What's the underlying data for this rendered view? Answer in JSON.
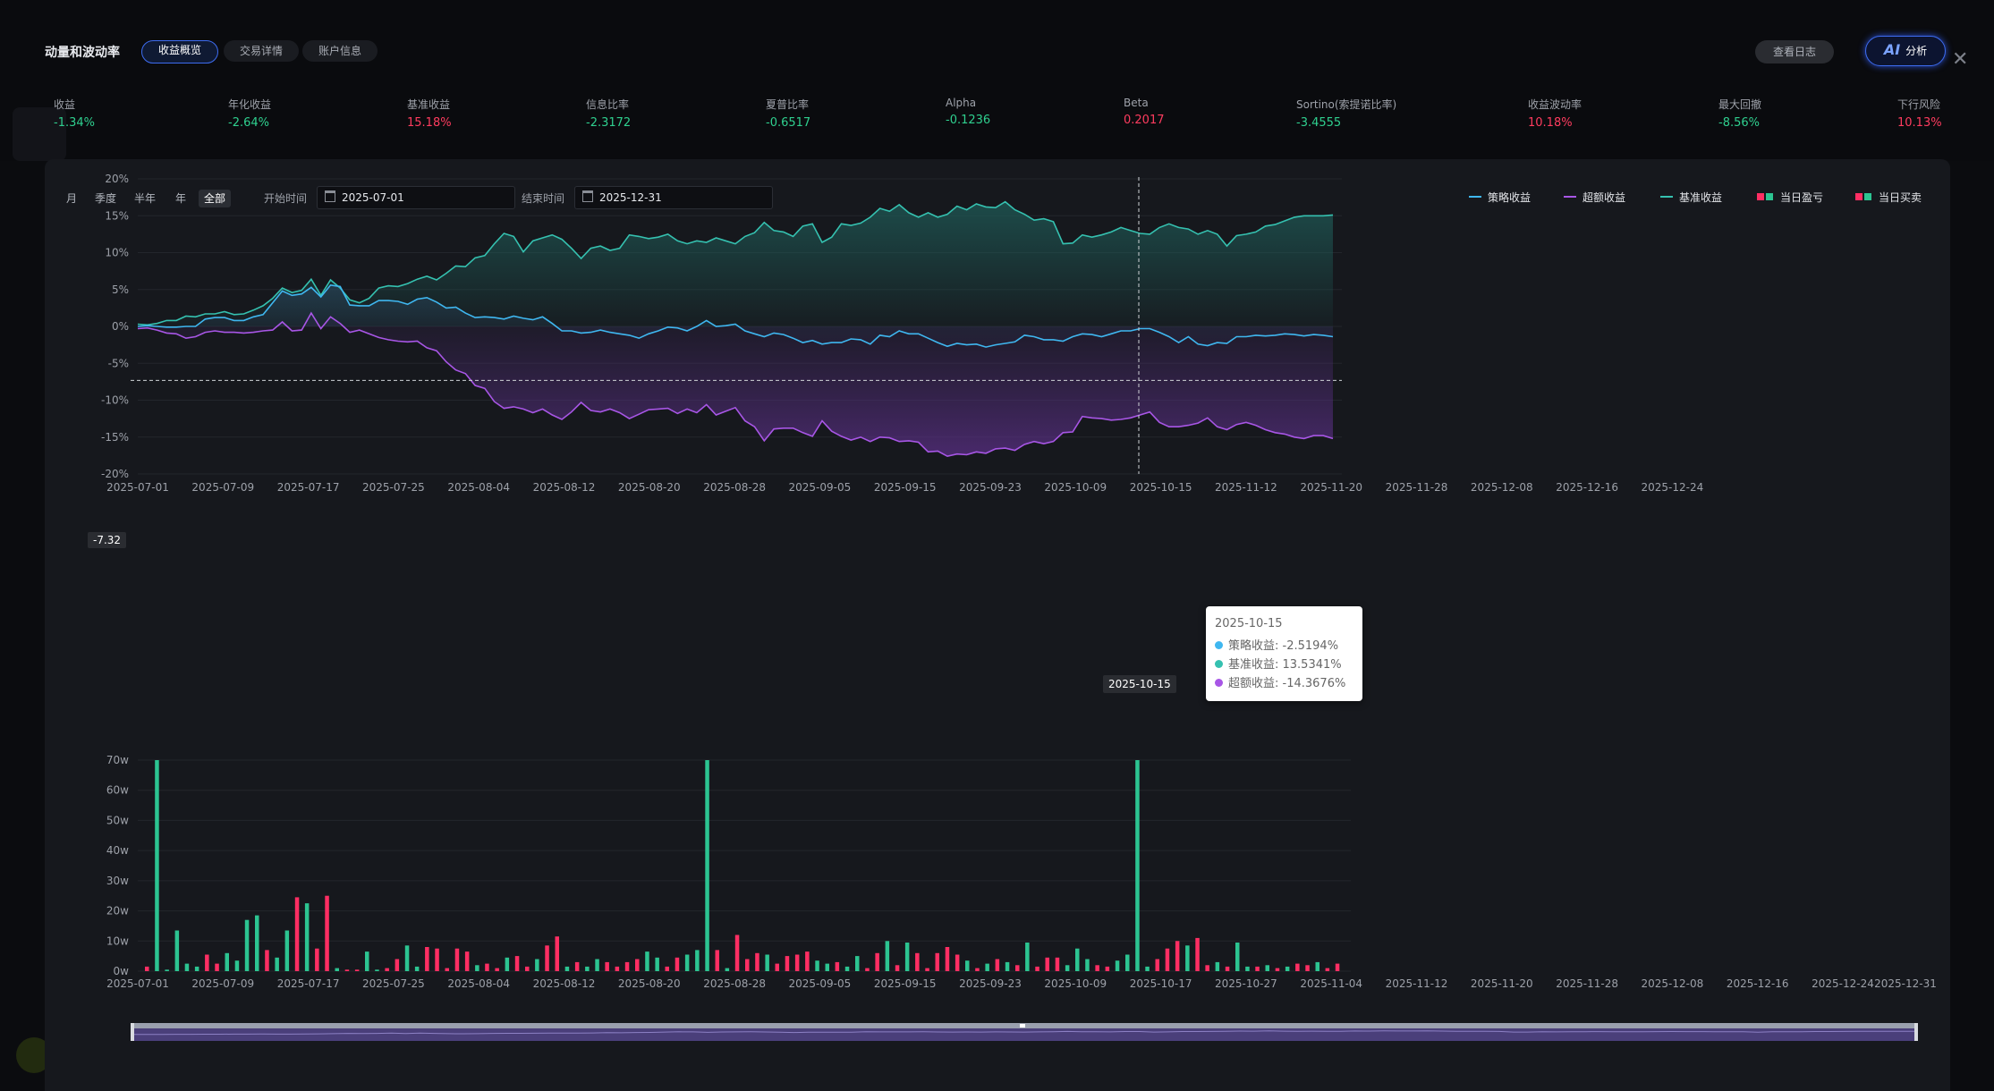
{
  "header": {
    "title": "动量和波动率",
    "tabs": [
      {
        "label": "收益概览",
        "active": true
      },
      {
        "label": "交易详情",
        "active": false
      },
      {
        "label": "账户信息",
        "active": false
      }
    ],
    "log_button": "查看日志",
    "ai_button": {
      "icon": "AI",
      "label": "分析"
    }
  },
  "metrics": [
    {
      "label": "收益",
      "value": "-1.34%",
      "color": "green"
    },
    {
      "label": "年化收益",
      "value": "-2.64%",
      "color": "green"
    },
    {
      "label": "基准收益",
      "value": "15.18%",
      "color": "red"
    },
    {
      "label": "信息比率",
      "value": "-2.3172",
      "color": "green"
    },
    {
      "label": "夏普比率",
      "value": "-0.6517",
      "color": "green"
    },
    {
      "label": "Alpha",
      "value": "-0.1236",
      "color": "green"
    },
    {
      "label": "Beta",
      "value": "0.2017",
      "color": "red"
    },
    {
      "label": "Sortino(索提诺比率)",
      "value": "-3.4555",
      "color": "green"
    },
    {
      "label": "收益波动率",
      "value": "10.18%",
      "color": "red"
    },
    {
      "label": "最大回撤",
      "value": "-8.56%",
      "color": "green"
    },
    {
      "label": "下行风险",
      "value": "10.13%",
      "color": "red"
    }
  ],
  "filters": {
    "periods": [
      {
        "label": "月",
        "active": false
      },
      {
        "label": "季度",
        "active": false
      },
      {
        "label": "半年",
        "active": false
      },
      {
        "label": "年",
        "active": false
      },
      {
        "label": "全部",
        "active": true
      }
    ],
    "start_label": "开始时间",
    "start_value": "2025-07-01",
    "end_label": "结束时间",
    "end_value": "2025-12-31"
  },
  "legend": [
    {
      "label": "策略收益",
      "type": "line",
      "color": "#3fb7f0"
    },
    {
      "label": "超额收益",
      "type": "line",
      "color": "#a856e6"
    },
    {
      "label": "基准收益",
      "type": "line",
      "color": "#35c1b0"
    },
    {
      "label": "当日盈亏",
      "type": "bar",
      "colors": [
        "#ff2e63",
        "#2cc491"
      ]
    },
    {
      "label": "当日买卖",
      "type": "bar",
      "colors": [
        "#ff2e63",
        "#2cc491"
      ]
    }
  ],
  "tooltip": {
    "date": "2025-10-15",
    "rows": [
      {
        "label": "策略收益: -2.5194%",
        "color": "#3fb7f0"
      },
      {
        "label": "基准收益: 13.5341%",
        "color": "#35c1b0"
      },
      {
        "label": "超额收益: -14.3676%",
        "color": "#a856e6"
      }
    ]
  },
  "crosshair": {
    "x_label": "2025-10-15",
    "y_label": "-7.32"
  },
  "chart_data": [
    {
      "type": "line",
      "y_ticks": [
        "20%",
        "15%",
        "10%",
        "5%",
        "0%",
        "-5%",
        "-10%",
        "-15%",
        "-20%"
      ],
      "ylim": [
        -20,
        20
      ],
      "x_ticks": [
        "2025-07-01",
        "2025-07-09",
        "2025-07-17",
        "2025-07-25",
        "2025-08-04",
        "2025-08-12",
        "2025-08-20",
        "2025-08-28",
        "2025-09-05",
        "2025-09-15",
        "2025-09-23",
        "2025-10-09",
        "2025-10-15",
        "2025-11-12",
        "2025-11-20",
        "2025-11-28",
        "2025-12-08",
        "2025-12-16",
        "2025-12-24"
      ],
      "series": [
        {
          "name": "基准收益",
          "color": "#35c1b0",
          "values": [
            0.3,
            0.2,
            0.4,
            0.8,
            0.8,
            1.4,
            1.3,
            1.7,
            1.7,
            2.0,
            1.6,
            1.7,
            2.2,
            2.8,
            3.8,
            5.2,
            4.6,
            4.9,
            6.4,
            4.2,
            6.3,
            5.2,
            3.6,
            3.2,
            3.8,
            5.2,
            5.5,
            5.4,
            5.8,
            6.4,
            6.8,
            6.3,
            7.2,
            8.2,
            8.1,
            9.3,
            9.6,
            11.2,
            12.6,
            12.2,
            10.1,
            11.6,
            12.0,
            12.4,
            11.8,
            10.6,
            9.2,
            10.6,
            10.9,
            10.3,
            10.6,
            12.4,
            12.2,
            11.9,
            12.1,
            12.5,
            11.6,
            11.2,
            11.6,
            11.4,
            12.0,
            11.6,
            11.2,
            12.2,
            12.7,
            14.1,
            13.0,
            12.8,
            12.2,
            13.6,
            13.9,
            11.4,
            12.1,
            13.9,
            13.7,
            14.0,
            14.8,
            16.0,
            15.6,
            16.5,
            15.4,
            14.8,
            15.4,
            14.8,
            15.2,
            16.3,
            15.8,
            16.6,
            16.2,
            16.1,
            16.9,
            15.8,
            15.2,
            14.4,
            14.6,
            14.2,
            11.2,
            11.3,
            12.4,
            12.1,
            12.4,
            12.8,
            13.4,
            13.0,
            12.6,
            12.5,
            13.4,
            13.9,
            13.4,
            13.2,
            12.5,
            13.0,
            12.5,
            10.9,
            12.3,
            12.5,
            12.8,
            13.6,
            13.8,
            14.3,
            14.8,
            15.0,
            15.0,
            15.0,
            15.1
          ]
        },
        {
          "name": "策略收益",
          "color": "#3fb7f0",
          "values": [
            0.0,
            0.1,
            0.0,
            -0.1,
            -0.1,
            0.0,
            0.0,
            1.0,
            1.2,
            1.2,
            0.8,
            0.8,
            1.3,
            1.6,
            3.2,
            4.8,
            4.2,
            4.4,
            5.3,
            4.0,
            5.6,
            5.4,
            2.9,
            2.8,
            2.8,
            3.5,
            3.5,
            3.4,
            3.0,
            3.7,
            3.9,
            3.3,
            2.5,
            2.6,
            1.8,
            1.2,
            1.3,
            1.2,
            1.0,
            1.4,
            1.1,
            0.9,
            1.3,
            0.4,
            -0.6,
            -0.6,
            -0.9,
            -0.8,
            -0.5,
            -0.8,
            -1.0,
            -1.2,
            -1.6,
            -1.0,
            -0.6,
            -0.1,
            -0.2,
            -0.6,
            0.0,
            0.8,
            0.0,
            0.1,
            0.3,
            -0.6,
            -1.0,
            -1.4,
            -0.9,
            -1.1,
            -1.6,
            -2.2,
            -1.9,
            -2.4,
            -2.2,
            -2.2,
            -1.7,
            -1.8,
            -2.4,
            -1.2,
            -1.4,
            -0.6,
            -1.0,
            -1.0,
            -1.6,
            -2.2,
            -2.7,
            -2.3,
            -2.5,
            -2.4,
            -2.8,
            -2.5,
            -2.3,
            -2.1,
            -1.2,
            -1.4,
            -1.8,
            -1.8,
            -2.0,
            -1.4,
            -1.0,
            -1.1,
            -1.4,
            -1.0,
            -0.6,
            -0.6,
            -0.3,
            -0.3,
            -0.8,
            -1.4,
            -2.2,
            -1.4,
            -2.4,
            -2.6,
            -2.2,
            -2.3,
            -1.4,
            -1.4,
            -1.2,
            -1.3,
            -1.2,
            -1.0,
            -1.1,
            -1.3,
            -1.1,
            -1.2,
            -1.4
          ]
        },
        {
          "name": "超额收益",
          "color": "#a856e6",
          "values": [
            -0.3,
            -0.2,
            -0.5,
            -0.9,
            -1.0,
            -1.6,
            -1.4,
            -0.8,
            -0.6,
            -0.8,
            -0.8,
            -0.9,
            -0.8,
            -0.6,
            -0.5,
            0.6,
            -0.6,
            -0.5,
            1.8,
            -0.3,
            1.3,
            0.4,
            -0.8,
            -0.5,
            -1.0,
            -1.5,
            -1.8,
            -2.0,
            -2.1,
            -2.0,
            -2.9,
            -3.3,
            -4.8,
            -5.9,
            -6.4,
            -8.0,
            -8.4,
            -10.2,
            -11.1,
            -10.9,
            -11.2,
            -11.7,
            -11.2,
            -12.0,
            -12.6,
            -11.6,
            -10.3,
            -11.4,
            -11.6,
            -11.2,
            -11.7,
            -12.5,
            -11.9,
            -11.3,
            -11.2,
            -11.1,
            -11.8,
            -11.2,
            -11.7,
            -10.6,
            -12.0,
            -11.5,
            -11.0,
            -12.8,
            -13.6,
            -15.5,
            -13.9,
            -13.8,
            -13.8,
            -14.4,
            -14.9,
            -12.8,
            -14.2,
            -14.9,
            -15.4,
            -15.0,
            -15.6,
            -15.0,
            -15.1,
            -15.6,
            -15.5,
            -15.7,
            -17.0,
            -16.9,
            -17.6,
            -17.3,
            -17.4,
            -17.0,
            -17.2,
            -16.6,
            -16.5,
            -16.8,
            -16.0,
            -15.6,
            -15.9,
            -15.6,
            -14.4,
            -14.3,
            -12.2,
            -12.4,
            -12.5,
            -12.7,
            -12.6,
            -12.4,
            -12.0,
            -11.6,
            -13.0,
            -13.6,
            -13.6,
            -13.4,
            -13.1,
            -12.4,
            -13.6,
            -14.0,
            -13.3,
            -13.0,
            -13.4,
            -14.0,
            -14.4,
            -14.6,
            -15.0,
            -15.2,
            -14.8,
            -14.8,
            -15.2
          ]
        }
      ]
    },
    {
      "type": "bar",
      "y_ticks": [
        "70w",
        "60w",
        "50w",
        "40w",
        "30w",
        "20w",
        "10w",
        "0w"
      ],
      "ylim": [
        0,
        70
      ],
      "x_ticks": [
        "2025-07-01",
        "2025-07-09",
        "2025-07-17",
        "2025-07-25",
        "2025-08-04",
        "2025-08-12",
        "2025-08-20",
        "2025-08-28",
        "2025-09-05",
        "2025-09-15",
        "2025-09-23",
        "2025-10-09",
        "2025-10-17",
        "2025-10-27",
        "2025-11-04",
        "2025-11-12",
        "2025-11-20",
        "2025-11-28",
        "2025-12-08",
        "2025-12-16",
        "2025-12-24",
        "2025-12-31"
      ],
      "bars": [
        {
          "v": 1.5,
          "s": "r"
        },
        {
          "v": 70,
          "s": "g"
        },
        {
          "v": 0.5,
          "s": "g"
        },
        {
          "v": 13.5,
          "s": "g"
        },
        {
          "v": 2.5,
          "s": "g"
        },
        {
          "v": 1.5,
          "s": "g"
        },
        {
          "v": 5.5,
          "s": "r"
        },
        {
          "v": 2.5,
          "s": "r"
        },
        {
          "v": 6,
          "s": "g"
        },
        {
          "v": 3.5,
          "s": "g"
        },
        {
          "v": 17,
          "s": "g"
        },
        {
          "v": 18.5,
          "s": "g"
        },
        {
          "v": 7,
          "s": "r"
        },
        {
          "v": 4.5,
          "s": "g"
        },
        {
          "v": 13.5,
          "s": "g"
        },
        {
          "v": 24.5,
          "s": "r"
        },
        {
          "v": 22.5,
          "s": "g"
        },
        {
          "v": 7.5,
          "s": "r"
        },
        {
          "v": 25,
          "s": "r"
        },
        {
          "v": 1,
          "s": "g"
        },
        {
          "v": 0.5,
          "s": "r"
        },
        {
          "v": 0.5,
          "s": "r"
        },
        {
          "v": 6.5,
          "s": "g"
        },
        {
          "v": 0.5,
          "s": "g"
        },
        {
          "v": 1,
          "s": "r"
        },
        {
          "v": 4,
          "s": "r"
        },
        {
          "v": 8.5,
          "s": "g"
        },
        {
          "v": 1.5,
          "s": "g"
        },
        {
          "v": 8,
          "s": "r"
        },
        {
          "v": 7.5,
          "s": "r"
        },
        {
          "v": 1,
          "s": "r"
        },
        {
          "v": 7.5,
          "s": "r"
        },
        {
          "v": 6.5,
          "s": "r"
        },
        {
          "v": 2,
          "s": "g"
        },
        {
          "v": 2.5,
          "s": "r"
        },
        {
          "v": 1,
          "s": "r"
        },
        {
          "v": 4.5,
          "s": "g"
        },
        {
          "v": 5,
          "s": "r"
        },
        {
          "v": 1.5,
          "s": "r"
        },
        {
          "v": 4,
          "s": "g"
        },
        {
          "v": 8.5,
          "s": "r"
        },
        {
          "v": 11.5,
          "s": "r"
        },
        {
          "v": 1.5,
          "s": "g"
        },
        {
          "v": 3,
          "s": "r"
        },
        {
          "v": 1.5,
          "s": "g"
        },
        {
          "v": 4,
          "s": "g"
        },
        {
          "v": 3,
          "s": "r"
        },
        {
          "v": 1.5,
          "s": "r"
        },
        {
          "v": 3,
          "s": "r"
        },
        {
          "v": 4,
          "s": "r"
        },
        {
          "v": 6.5,
          "s": "g"
        },
        {
          "v": 4.5,
          "s": "g"
        },
        {
          "v": 1.5,
          "s": "r"
        },
        {
          "v": 4.5,
          "s": "r"
        },
        {
          "v": 5.5,
          "s": "g"
        },
        {
          "v": 7,
          "s": "g"
        },
        {
          "v": 70,
          "s": "g"
        },
        {
          "v": 7,
          "s": "r"
        },
        {
          "v": 1,
          "s": "g"
        },
        {
          "v": 12,
          "s": "r"
        },
        {
          "v": 4,
          "s": "r"
        },
        {
          "v": 6,
          "s": "r"
        },
        {
          "v": 5.5,
          "s": "g"
        },
        {
          "v": 2.5,
          "s": "r"
        },
        {
          "v": 5,
          "s": "r"
        },
        {
          "v": 5.5,
          "s": "r"
        },
        {
          "v": 6.5,
          "s": "r"
        },
        {
          "v": 3.5,
          "s": "g"
        },
        {
          "v": 2.5,
          "s": "g"
        },
        {
          "v": 3,
          "s": "r"
        },
        {
          "v": 1.5,
          "s": "g"
        },
        {
          "v": 5,
          "s": "g"
        },
        {
          "v": 1,
          "s": "r"
        },
        {
          "v": 6,
          "s": "r"
        },
        {
          "v": 10,
          "s": "g"
        },
        {
          "v": 2,
          "s": "r"
        },
        {
          "v": 9.5,
          "s": "g"
        },
        {
          "v": 6,
          "s": "r"
        },
        {
          "v": 1,
          "s": "r"
        },
        {
          "v": 6,
          "s": "r"
        },
        {
          "v": 8,
          "s": "r"
        },
        {
          "v": 5.5,
          "s": "r"
        },
        {
          "v": 3.5,
          "s": "g"
        },
        {
          "v": 1,
          "s": "r"
        },
        {
          "v": 2.5,
          "s": "g"
        },
        {
          "v": 4,
          "s": "r"
        },
        {
          "v": 3,
          "s": "g"
        },
        {
          "v": 2,
          "s": "r"
        },
        {
          "v": 9.5,
          "s": "g"
        },
        {
          "v": 1.5,
          "s": "r"
        },
        {
          "v": 4.5,
          "s": "r"
        },
        {
          "v": 4.5,
          "s": "r"
        },
        {
          "v": 2,
          "s": "g"
        },
        {
          "v": 7.5,
          "s": "g"
        },
        {
          "v": 4,
          "s": "g"
        },
        {
          "v": 2,
          "s": "r"
        },
        {
          "v": 1.5,
          "s": "r"
        },
        {
          "v": 3.5,
          "s": "g"
        },
        {
          "v": 5.5,
          "s": "g"
        },
        {
          "v": 70,
          "s": "g"
        },
        {
          "v": 1.5,
          "s": "g"
        },
        {
          "v": 4,
          "s": "r"
        },
        {
          "v": 7.5,
          "s": "r"
        },
        {
          "v": 10,
          "s": "r"
        },
        {
          "v": 8.5,
          "s": "g"
        },
        {
          "v": 11,
          "s": "r"
        },
        {
          "v": 2,
          "s": "r"
        },
        {
          "v": 3,
          "s": "g"
        },
        {
          "v": 1.5,
          "s": "r"
        },
        {
          "v": 9.5,
          "s": "g"
        },
        {
          "v": 1.5,
          "s": "g"
        },
        {
          "v": 1.5,
          "s": "r"
        },
        {
          "v": 2,
          "s": "g"
        },
        {
          "v": 1,
          "s": "r"
        },
        {
          "v": 1.5,
          "s": "g"
        },
        {
          "v": 2.5,
          "s": "r"
        },
        {
          "v": 2,
          "s": "r"
        },
        {
          "v": 3,
          "s": "g"
        },
        {
          "v": 1,
          "s": "r"
        },
        {
          "v": 2.5,
          "s": "r"
        }
      ]
    }
  ]
}
